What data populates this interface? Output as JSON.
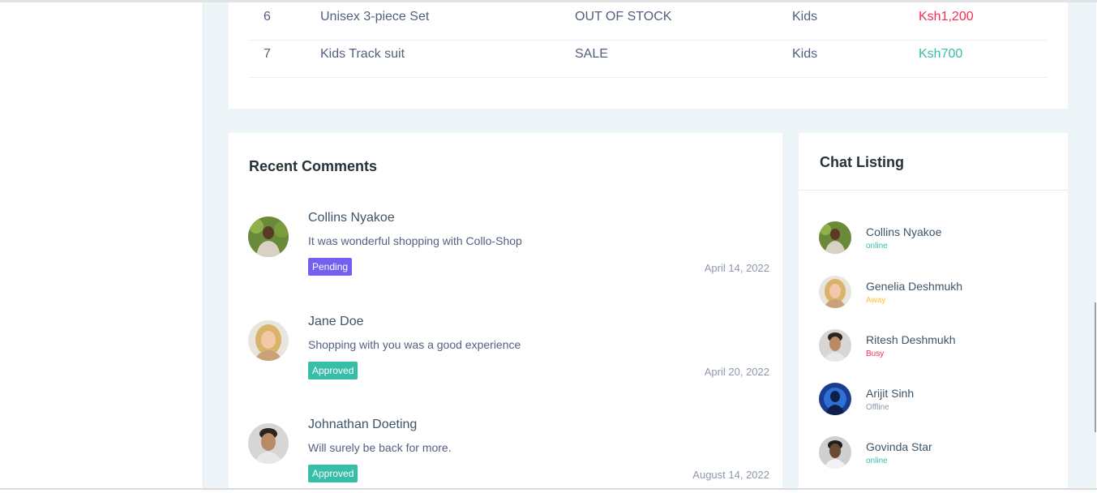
{
  "products": {
    "rows": [
      {
        "no": "6",
        "name": "Unisex 3-piece Set",
        "status": "OUT OF STOCK",
        "category": "Kids",
        "price": "Ksh1,200",
        "price_color": "#f62d51"
      },
      {
        "no": "7",
        "name": "Kids Track suit",
        "status": "SALE",
        "category": "Kids",
        "price": "Ksh700",
        "price_color": "#36bea6"
      }
    ]
  },
  "comments": {
    "title": "Recent Comments",
    "items": [
      {
        "author": "Collins Nyakoe",
        "text": "It was wonderful shopping with Collo-Shop",
        "badge": "Pending",
        "date": "April 14, 2022"
      },
      {
        "author": "Jane Doe",
        "text": "Shopping with you was a good experience",
        "badge": "Approved",
        "date": "April 20, 2022"
      },
      {
        "author": "Johnathan Doeting",
        "text": "Will surely be back for more.",
        "badge": "Approved",
        "date": "August 14, 2022"
      }
    ]
  },
  "chat": {
    "title": "Chat Listing",
    "items": [
      {
        "name": "Collins Nyakoe",
        "status": "online",
        "status_color": "#36bea6"
      },
      {
        "name": "Genelia Deshmukh",
        "status": "Away",
        "status_color": "#ffbc34"
      },
      {
        "name": "Ritesh Deshmukh",
        "status": "Busy",
        "status_color": "#f62d51"
      },
      {
        "name": "Arijit Sinh",
        "status": "Offline",
        "status_color": "#8d97ad"
      },
      {
        "name": "Govinda Star",
        "status": "online",
        "status_color": "#36bea6"
      }
    ]
  },
  "colors": {
    "badge_pending": "#7460ee",
    "badge_approved": "#36bea6",
    "page_background": "#eef5f9"
  }
}
